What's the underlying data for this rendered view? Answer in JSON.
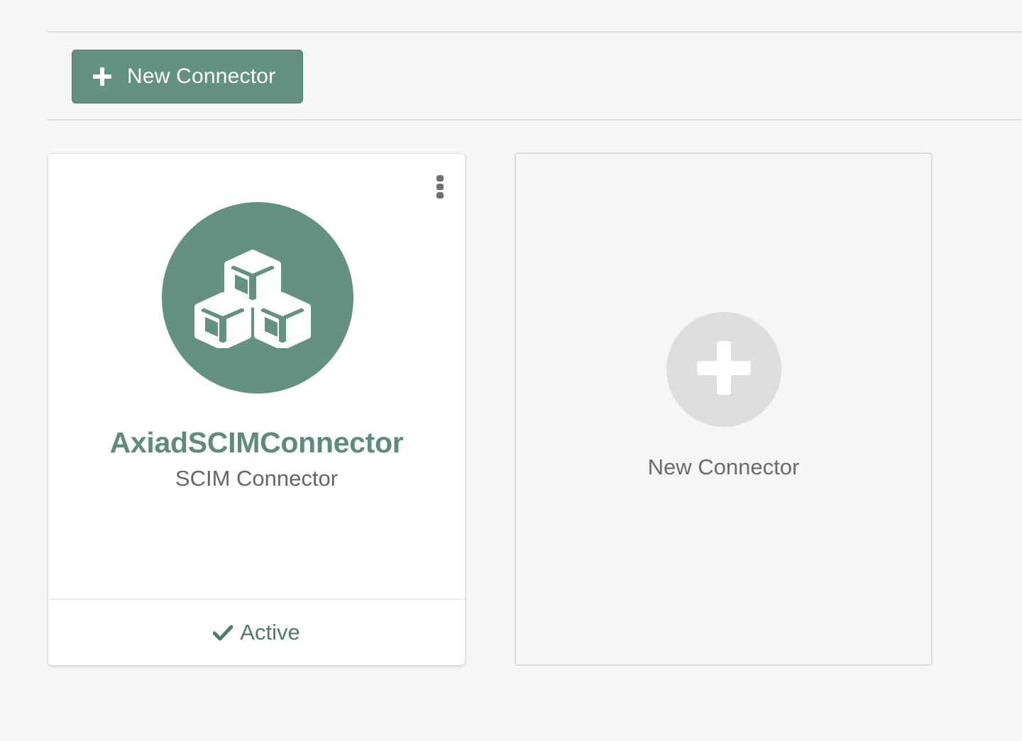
{
  "toolbar": {
    "new_connector_label": "New Connector",
    "new_connector_icon": "plus-icon"
  },
  "connectors": [
    {
      "name": "AxiadSCIMConnector",
      "type": "SCIM Connector",
      "status": "Active",
      "logo_icon": "cubes-icon",
      "menu_icon": "kebab-menu-icon",
      "status_icon": "check-icon"
    }
  ],
  "add_card": {
    "label": "New Connector",
    "icon": "plus-icon"
  },
  "colors": {
    "accent": "#639183",
    "accent_text": "#5d8b7d",
    "page_background": "#f6f6f6",
    "card_background": "#ffffff",
    "add_circle": "#dedede"
  }
}
